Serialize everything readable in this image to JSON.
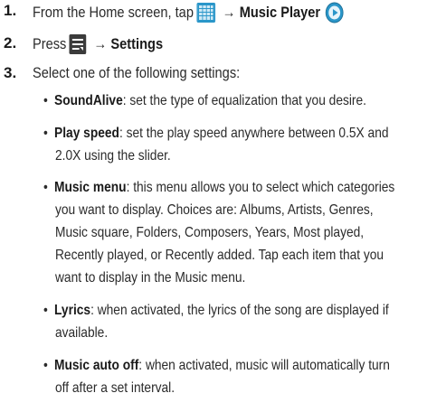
{
  "intro": "... from the Home screen, tap",
  "steps": [
    {
      "number": "1.",
      "prefix": "From the Home screen, tap",
      "arrow": "→",
      "target": "Music Player",
      "icons": [
        "apps-grid-icon",
        "music-player-icon"
      ]
    },
    {
      "number": "2.",
      "prefix": "Press",
      "arrow": "→",
      "target": "Settings",
      "icons": [
        "menu-icon"
      ]
    },
    {
      "number": "3.",
      "prefix": "Select one of the following settings:"
    }
  ],
  "settings": [
    {
      "name": "SoundAlive",
      "lines": [
        ": set the type of equalization that you desire."
      ]
    },
    {
      "name": "Play speed",
      "lines": [
        ": set the play speed anywhere between 0.5X and",
        "2.0X using the slider."
      ]
    },
    {
      "name": "Music menu",
      "lines": [
        ": this menu allows you to select which categories",
        "you want to display. Choices are: Albums, Artists, Genres,",
        "Music square, Folders, Composers, Years, Most played,",
        "Recently played, or Recently added. Tap each item that you",
        "want to display in the Music menu."
      ]
    },
    {
      "name": "Lyrics",
      "lines": [
        ": when activated, the lyrics of the song are displayed if",
        "available."
      ]
    },
    {
      "name": "Music auto off",
      "lines": [
        ": when activated, music will automatically turn",
        "off after a set interval."
      ]
    }
  ],
  "colors": {
    "text": "#2a2a2a",
    "icon_blue": "#2a96c9",
    "menu_dark": "#3b3b3b"
  }
}
